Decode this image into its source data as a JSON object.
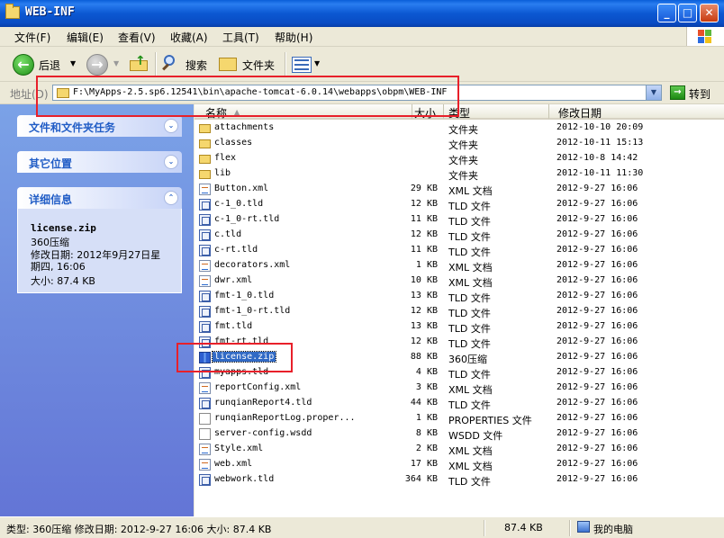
{
  "window": {
    "title": "WEB-INF"
  },
  "menu": [
    "文件(F)",
    "编辑(E)",
    "查看(V)",
    "收藏(A)",
    "工具(T)",
    "帮助(H)"
  ],
  "toolbar": {
    "back": "后退",
    "search": "搜索",
    "folders": "文件夹"
  },
  "address": {
    "label": "地址(D)",
    "path": "F:\\MyApps-2.5.sp6.12541\\bin\\apache-tomcat-6.0.14\\webapps\\obpm\\WEB-INF",
    "go": "转到"
  },
  "sidebar": {
    "tasks_title": "文件和文件夹任务",
    "other_title": "其它位置",
    "details_title": "详细信息",
    "details": {
      "file_name": "license.zip",
      "file_type": "360压缩",
      "modified_line1": "修改日期: 2012年9月27日星",
      "modified_line2": "期四, 16:06",
      "size": "大小: 87.4 KB"
    }
  },
  "columns": {
    "name": "名称",
    "size": "大小",
    "type": "类型",
    "modified": "修改日期"
  },
  "files": [
    {
      "icon": "folder",
      "name": "attachments",
      "size": "",
      "type": "文件夹",
      "modified": "2012-10-10 20:09"
    },
    {
      "icon": "folder",
      "name": "classes",
      "size": "",
      "type": "文件夹",
      "modified": "2012-10-11 15:13"
    },
    {
      "icon": "folder",
      "name": "flex",
      "size": "",
      "type": "文件夹",
      "modified": "2012-10-8 14:42"
    },
    {
      "icon": "folder",
      "name": "lib",
      "size": "",
      "type": "文件夹",
      "modified": "2012-10-11 11:30"
    },
    {
      "icon": "xml",
      "name": "Button.xml",
      "size": "29 KB",
      "type": "XML 文档",
      "modified": "2012-9-27 16:06"
    },
    {
      "icon": "tld",
      "name": "c-1_0.tld",
      "size": "12 KB",
      "type": "TLD 文件",
      "modified": "2012-9-27 16:06"
    },
    {
      "icon": "tld",
      "name": "c-1_0-rt.tld",
      "size": "11 KB",
      "type": "TLD 文件",
      "modified": "2012-9-27 16:06"
    },
    {
      "icon": "tld",
      "name": "c.tld",
      "size": "12 KB",
      "type": "TLD 文件",
      "modified": "2012-9-27 16:06"
    },
    {
      "icon": "tld",
      "name": "c-rt.tld",
      "size": "11 KB",
      "type": "TLD 文件",
      "modified": "2012-9-27 16:06"
    },
    {
      "icon": "xml",
      "name": "decorators.xml",
      "size": "1 KB",
      "type": "XML 文档",
      "modified": "2012-9-27 16:06"
    },
    {
      "icon": "xml",
      "name": "dwr.xml",
      "size": "10 KB",
      "type": "XML 文档",
      "modified": "2012-9-27 16:06"
    },
    {
      "icon": "tld",
      "name": "fmt-1_0.tld",
      "size": "13 KB",
      "type": "TLD 文件",
      "modified": "2012-9-27 16:06"
    },
    {
      "icon": "tld",
      "name": "fmt-1_0-rt.tld",
      "size": "12 KB",
      "type": "TLD 文件",
      "modified": "2012-9-27 16:06"
    },
    {
      "icon": "tld",
      "name": "fmt.tld",
      "size": "13 KB",
      "type": "TLD 文件",
      "modified": "2012-9-27 16:06"
    },
    {
      "icon": "tld",
      "name": "fmt-rt.tld",
      "size": "12 KB",
      "type": "TLD 文件",
      "modified": "2012-9-27 16:06"
    },
    {
      "icon": "zip",
      "name": "license.zip",
      "size": "88 KB",
      "type": "360压缩",
      "modified": "2012-9-27 16:06",
      "selected": true
    },
    {
      "icon": "tld",
      "name": "myapps.tld",
      "size": "4 KB",
      "type": "TLD 文件",
      "modified": "2012-9-27 16:06"
    },
    {
      "icon": "xml",
      "name": "reportConfig.xml",
      "size": "3 KB",
      "type": "XML 文档",
      "modified": "2012-9-27 16:06"
    },
    {
      "icon": "tld",
      "name": "runqianReport4.tld",
      "size": "44 KB",
      "type": "TLD 文件",
      "modified": "2012-9-27 16:06"
    },
    {
      "icon": "file",
      "name": "runqianReportLog.proper...",
      "size": "1 KB",
      "type": "PROPERTIES 文件",
      "modified": "2012-9-27 16:06"
    },
    {
      "icon": "file",
      "name": "server-config.wsdd",
      "size": "8 KB",
      "type": "WSDD 文件",
      "modified": "2012-9-27 16:06"
    },
    {
      "icon": "xml",
      "name": "Style.xml",
      "size": "2 KB",
      "type": "XML 文档",
      "modified": "2012-9-27 16:06"
    },
    {
      "icon": "xml",
      "name": "web.xml",
      "size": "17 KB",
      "type": "XML 文档",
      "modified": "2012-9-27 16:06"
    },
    {
      "icon": "tld",
      "name": "webwork.tld",
      "size": "364 KB",
      "type": "TLD 文件",
      "modified": "2012-9-27 16:06"
    }
  ],
  "status": {
    "info": "类型: 360压缩 修改日期: 2012-9-27 16:06 大小: 87.4 KB",
    "size": "87.4 KB",
    "location": "我的电脑"
  },
  "colors": {
    "title_bar": "#0a5fd8",
    "sidebar": "#7ba2e7",
    "selection": "#316ac5",
    "annotation": "#e8202a"
  }
}
